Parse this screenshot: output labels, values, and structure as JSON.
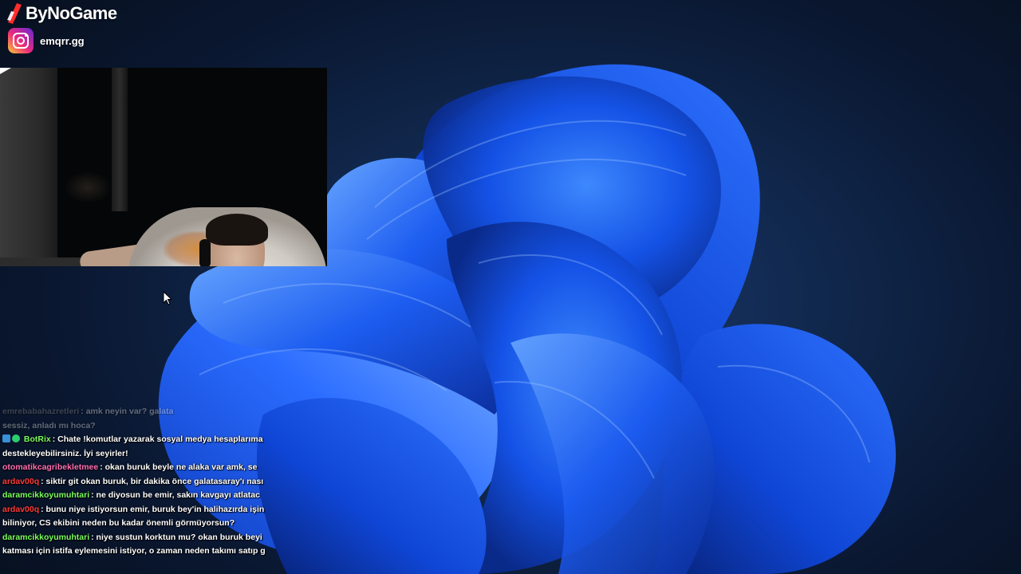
{
  "brand": {
    "name": "ByNoGame"
  },
  "social": {
    "platform_icon": "instagram-icon",
    "handle": "emqrr.gg"
  },
  "webcam": {
    "label": "webcam feed"
  },
  "chat": {
    "messages": [
      {
        "user": "emrebabahazretleri",
        "user_color": "#9a9a9a",
        "text": ": amk neyin var? galata",
        "faded": true
      },
      {
        "user": "",
        "user_color": "#9a9a9a",
        "text": "sessiz, anladı mı hoca?",
        "faded": true
      },
      {
        "user": "BotRix",
        "user_color": "#7cff5e",
        "badges": [
          "bot-badge",
          "verified-badge"
        ],
        "text": ": Chate !komutlar yazarak sosyal medya hesaplarıma"
      },
      {
        "user": "",
        "user_color": "#ffffff",
        "text": "destekleyebilirsiniz. İyi seyirler!"
      },
      {
        "user": "otomatikcagribekletmee",
        "user_color": "#ff6eb4",
        "text": ": okan buruk beyle ne alaka var amk, se"
      },
      {
        "user": "ardav00q",
        "user_color": "#ff3b3b",
        "text": ": siktir git okan buruk, bir dakika önce galatasaray'ı nası"
      },
      {
        "user": "daramcikkoyumuhtari",
        "user_color": "#7cff5e",
        "text": ": ne diyosun be emir, sakın kavgayı atlatac"
      },
      {
        "user": "ardav00q",
        "user_color": "#ff3b3b",
        "text": ": bunu niye istiyorsun emir, buruk bey'in halihazırda işin"
      },
      {
        "user": "",
        "user_color": "#ffffff",
        "text": "biliniyor, CS ekibini neden bu kadar önemli görmüyorsun?"
      },
      {
        "user": "daramcikkoyumuhtari",
        "user_color": "#7cff5e",
        "text": ": niye sustun korktun mu? okan buruk beyi"
      },
      {
        "user": "",
        "user_color": "#ffffff",
        "text": "katması için istifa eylemesini istiyor, o zaman neden takımı satıp g"
      }
    ]
  },
  "colors": {
    "accent": "#1f5fff",
    "background": "#0a1526"
  }
}
